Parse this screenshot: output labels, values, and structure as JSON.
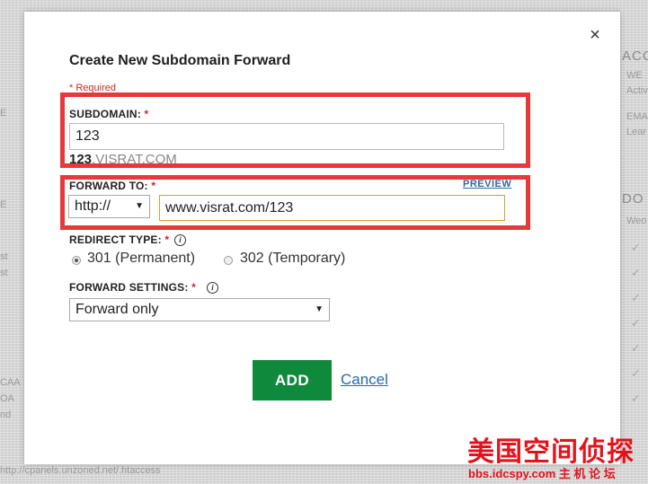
{
  "background": {
    "left_texts": [
      "E",
      "st",
      "st",
      "CAA",
      "OA",
      "cen",
      "nd"
    ],
    "right_texts": [
      "ACC",
      "WE",
      "Activ",
      "EMA",
      "Lear",
      "DO",
      "Weo"
    ],
    "bottom_text": "http://cpanels.unzoned.net/.htaccess"
  },
  "dialog": {
    "close_symbol": "×",
    "title": "Create New Subdomain Forward",
    "required_note": "* Required",
    "subdomain": {
      "label": "SUBDOMAIN:",
      "required_mark": "*",
      "value": "123",
      "preview_prefix": "123",
      "preview_domain": ".VISRAT.COM"
    },
    "forward_to": {
      "label": "FORWARD TO:",
      "required_mark": "*",
      "preview_link": "PREVIEW",
      "protocol": "http://",
      "url_value": "www.visrat.com/123"
    },
    "redirect_type": {
      "label": "REDIRECT TYPE:",
      "required_mark": "*",
      "options": [
        {
          "label": "301 (Permanent)",
          "checked": true
        },
        {
          "label": "302 (Temporary)",
          "checked": false
        }
      ]
    },
    "forward_settings": {
      "label": "FORWARD SETTINGS:",
      "required_mark": "*",
      "selected": "Forward only"
    },
    "add_button": "ADD",
    "cancel_link": "Cancel"
  },
  "icons": {
    "info": "i",
    "dropdown_arrow": "▼"
  },
  "watermark": {
    "chinese": "美国空间侦探",
    "url": "bbs.idcspy.com 主 机 论 坛"
  },
  "colors": {
    "highlight": "#e8383c",
    "add_button": "#0f8a3c",
    "link": "#2a6aa6",
    "required": "#d0261f"
  }
}
